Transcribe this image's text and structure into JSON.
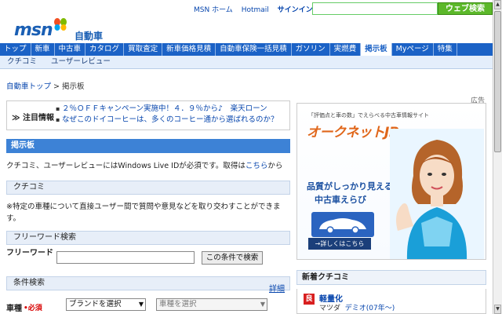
{
  "header": {
    "links": [
      "MSN ホーム",
      "Hotmail",
      "サインイン"
    ],
    "search_placeholder": "",
    "search_button": "ウェブ検索",
    "logo": "msn",
    "section": "自動車"
  },
  "nav": {
    "items": [
      "トップ",
      "新車",
      "中古車",
      "カタログ",
      "買取査定",
      "新車価格見積",
      "自動車保険一括見積",
      "ガソリン",
      "実燃費",
      "掲示板",
      "Myページ",
      "特集"
    ],
    "active": "掲示板",
    "sub_items": [
      "クチコミ",
      "ユーザーレビュー"
    ]
  },
  "breadcrumb": {
    "home": "自動車トップ",
    "separator": ">",
    "current": "掲示板"
  },
  "notice": {
    "label": "注目情報",
    "items": [
      "２％ＯＦＦキャンペーン実施中！４．９％から♪　楽天ローン",
      "なぜこのドイコーヒーは、多くのコーヒー通から選ばれるのか？"
    ]
  },
  "board": {
    "title": "掲示板",
    "intro_text": "クチコミ、ユーザーレビューにはWindows Live IDが必須です。取得は",
    "intro_link": "こちら",
    "intro_suffix": "から",
    "kuchikomi_title": "クチコミ",
    "kuchikomi_text": "※特定の車種について直接ユーザー間で質問や意見などを取り交わすことができます。",
    "freeword_title": "フリーワード検索",
    "freeword_label": "フリーワード",
    "freeword_button": "この条件で検索",
    "condition_title": "条件検索",
    "detail_link": "詳細",
    "vehicle_label": "車種",
    "required_label": "•必須",
    "brand_select": "ブランドを選択",
    "model_select": "車種を選択"
  },
  "ad": {
    "label": "広告",
    "tagline": "「評価点と車の数」でえらべる中古車情報サイト",
    "brand": "オークネットJP",
    "copy_line1": "品質がしっかり見える",
    "copy_line2": "中古車えらび",
    "cta": "→詳しくはこちら"
  },
  "sidebar": {
    "latest_title": "新着クチコミ",
    "item_badge": "良",
    "item_title": "軽量化",
    "item_maker": "マツダ",
    "item_model": "デミオ(07年〜)"
  },
  "colors": {
    "nav_blue": "#1b62c6",
    "header_blue": "#3d82d6",
    "search_green": "#5cb82a",
    "ad_orange": "#e0661a"
  }
}
